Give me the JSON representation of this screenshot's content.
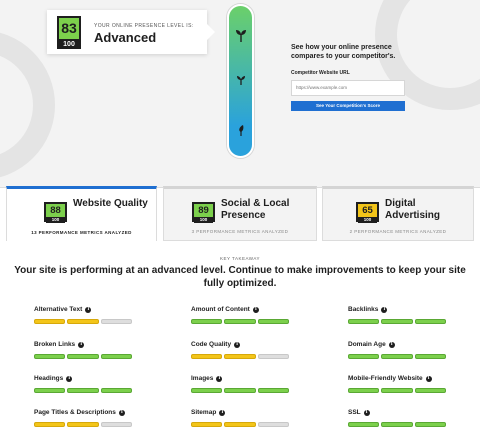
{
  "hero": {
    "level_label": "YOUR ONLINE PRESENCE LEVEL IS:",
    "level_value": "Advanced",
    "score": "83",
    "score_max": "100",
    "compare_title": "See how your online presence compares to your competitor's.",
    "competitor_label": "Competitor Website URL",
    "competitor_placeholder": "https://www.example.com",
    "competitor_button": "See Your Competition's Score"
  },
  "tabs": [
    {
      "score": "88",
      "max": "100",
      "title": "Website Quality",
      "metrics": "13 PERFORMANCE METRICS ANALYZED",
      "color": "#7cd04c"
    },
    {
      "score": "89",
      "max": "100",
      "title": "Social & Local Presence",
      "metrics": "3 PERFORMANCE METRICS ANALYZED",
      "color": "#7cd04c"
    },
    {
      "score": "65",
      "max": "100",
      "title": "Digital Advertising",
      "metrics": "2 PERFORMANCE METRICS ANALYZED",
      "color": "#f3c519"
    }
  ],
  "takeaway": {
    "label": "KEY TAKEAWAY",
    "text": "Your site is performing at an advanced level. Continue to make improvements to keep your site fully optimized."
  },
  "metrics": [
    {
      "name": "Alternative Text",
      "status": "yellow",
      "filled": 2
    },
    {
      "name": "Amount of Content",
      "status": "green",
      "filled": 3
    },
    {
      "name": "Backlinks",
      "status": "green",
      "filled": 3
    },
    {
      "name": "Broken Links",
      "status": "green",
      "filled": 3
    },
    {
      "name": "Code Quality",
      "status": "yellow",
      "filled": 2
    },
    {
      "name": "Domain Age",
      "status": "green",
      "filled": 3
    },
    {
      "name": "Headings",
      "status": "green",
      "filled": 3
    },
    {
      "name": "Images",
      "status": "green",
      "filled": 3
    },
    {
      "name": "Mobile-Friendly Website",
      "status": "green",
      "filled": 3
    },
    {
      "name": "Page Titles & Descriptions",
      "status": "yellow",
      "filled": 2
    },
    {
      "name": "Sitemap",
      "status": "yellow",
      "filled": 2
    },
    {
      "name": "SSL",
      "status": "green",
      "filled": 3
    }
  ]
}
